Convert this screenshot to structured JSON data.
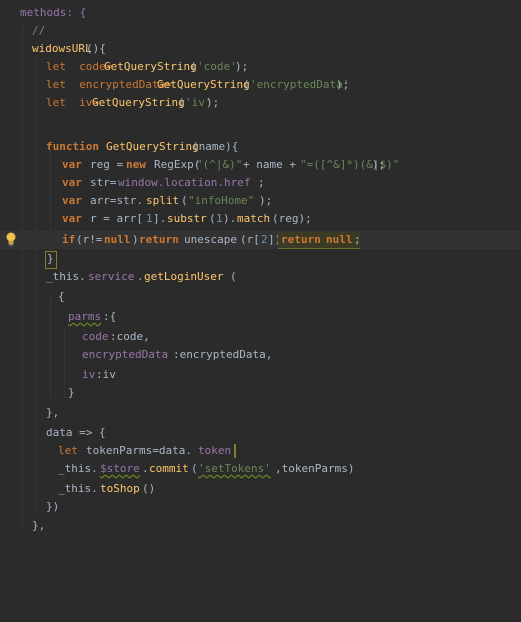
{
  "colors": {
    "background": "#2b2b2b",
    "keyword": "#cc7832",
    "function": "#ffc66d",
    "string": "#6a8759",
    "property": "#9876aa",
    "comment": "#808080",
    "text": "#a9b7c6"
  },
  "icons": {
    "intention": "lightbulb-icon"
  },
  "code": {
    "l01": "methods: {",
    "l02": "//",
    "l03a": "widowsURL",
    "l03b": "(){",
    "l04a": "let  code=",
    "l04b": "GetQueryString",
    "l04c": "(",
    "l04d": "'code'",
    "l04e": ");",
    "l05a": "let  encryptedData=",
    "l05b": "GetQueryString",
    "l05c": "(",
    "l05d": "'encryptedData'",
    "l05e": ");",
    "l06a": "let  iv=",
    "l06b": "GetQueryString",
    "l06c": "(",
    "l06d": "'iv'",
    "l06e": ");",
    "l08a": "function ",
    "l08b": "GetQueryString",
    "l08c": "(name){",
    "l09a": "var ",
    "l09b": "reg = ",
    "l09c": "new ",
    "l09d": "RegExp(",
    "l09e": "\"(^|&)\"",
    "l09f": "+ name +",
    "l09g": "\"=([^&]*)(&|$)\"",
    "l09h": ");",
    "l10a": "var ",
    "l10b": "str=",
    "l10c": "window.location.href",
    "l10d": ";",
    "l11a": "var ",
    "l11b": "arr=str.",
    "l11c": "split",
    "l11d": "(",
    "l11e": "\"infoHome\"",
    "l11f": ");",
    "l12a": "var ",
    "l12b": "r = arr[",
    "l12c": "1",
    "l12d": "].",
    "l12e": "substr",
    "l12f": "(",
    "l12g": "1",
    "l12h": ").",
    "l12i": "match",
    "l12j": "(reg);",
    "l13a": "if",
    "l13b": "(r!=",
    "l13c": "null",
    "l13d": ")",
    "l13e": "return ",
    "l13f": "unescape",
    "l13g": "(r[",
    "l13h": "2",
    "l13i": "]);",
    "l13j": "return ",
    "l13k": "null",
    "l13l": ";",
    "l14": "}",
    "l15a": "_this.",
    "l15b": "service",
    "l15c": ".",
    "l15d": "getLoginUser",
    "l15e": "(",
    "l16": "{",
    "l17a": "parms",
    "l17b": ":{",
    "l18a": "code",
    "l18b": ":code,",
    "l19a": "encryptedData",
    "l19b": ":encryptedData,",
    "l20a": "iv",
    "l20b": ":iv",
    "l21": "}",
    "l22": "},",
    "l23": "data => {",
    "l24a": "let ",
    "l24b": "tokenParms=data.",
    "l24c": "token",
    "l25a": "_this.",
    "l25b": "$store",
    "l25c": ".",
    "l25d": "commit",
    "l25e": "(",
    "l25f": "'setTokens'",
    "l25g": ",tokenParms)",
    "l26a": "_this.",
    "l26b": "toShop",
    "l26c": "()",
    "l27": "})",
    "l28": "},"
  }
}
